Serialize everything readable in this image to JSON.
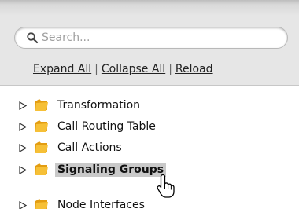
{
  "search": {
    "placeholder": "Search..."
  },
  "links": {
    "expand_all": "Expand All",
    "collapse_all": "Collapse All",
    "reload": "Reload",
    "separator": "|"
  },
  "tree": {
    "items": [
      {
        "label": "Transformation",
        "selected": false
      },
      {
        "label": "Call Routing Table",
        "selected": false
      },
      {
        "label": "Call Actions",
        "selected": false
      },
      {
        "label": "Signaling Groups",
        "selected": true
      },
      {
        "label": "Node Interfaces",
        "selected": false
      }
    ]
  },
  "colors": {
    "folder": "#f2b01e",
    "selection": "#c9c9c9",
    "header": "#e6e6e6"
  }
}
